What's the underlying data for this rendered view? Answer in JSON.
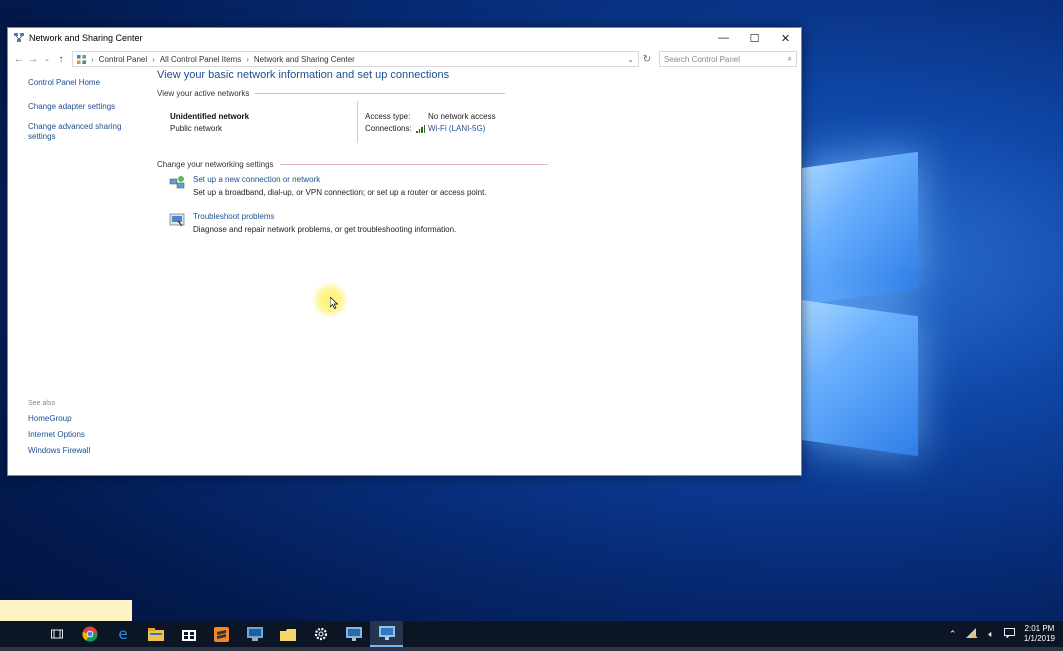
{
  "window": {
    "title": "Network and Sharing Center",
    "minimize": "—",
    "maximize": "☐",
    "close": "✕"
  },
  "address": {
    "crumbs": [
      "Control Panel",
      "All Control Panel Items",
      "Network and Sharing Center"
    ],
    "search_placeholder": "Search Control Panel"
  },
  "leftnav": {
    "home": "Control Panel Home",
    "items": [
      "Change adapter settings",
      "Change advanced sharing settings"
    ],
    "see_also_label": "See also",
    "see_also": [
      "HomeGroup",
      "Internet Options",
      "Windows Firewall"
    ]
  },
  "main": {
    "heading": "View your basic network information and set up connections",
    "active_label": "View your active networks",
    "network": {
      "name": "Unidentified network",
      "type": "Public network",
      "access_label": "Access type:",
      "access_value": "No network access",
      "connections_label": "Connections:",
      "connections_value": "Wi-Fi (LANI-5G)"
    },
    "change_label": "Change your networking settings",
    "tasks": [
      {
        "link": "Set up a new connection or network",
        "desc": "Set up a broadband, dial-up, or VPN connection; or set up a router or access point."
      },
      {
        "link": "Troubleshoot problems",
        "desc": "Diagnose and repair network problems, or get troubleshooting information."
      }
    ]
  },
  "taskbar": {
    "time": "2:01 PM",
    "date": "1/1/2019"
  },
  "colors": {
    "link": "#1e4f91",
    "taskbar": "#0c1524"
  }
}
